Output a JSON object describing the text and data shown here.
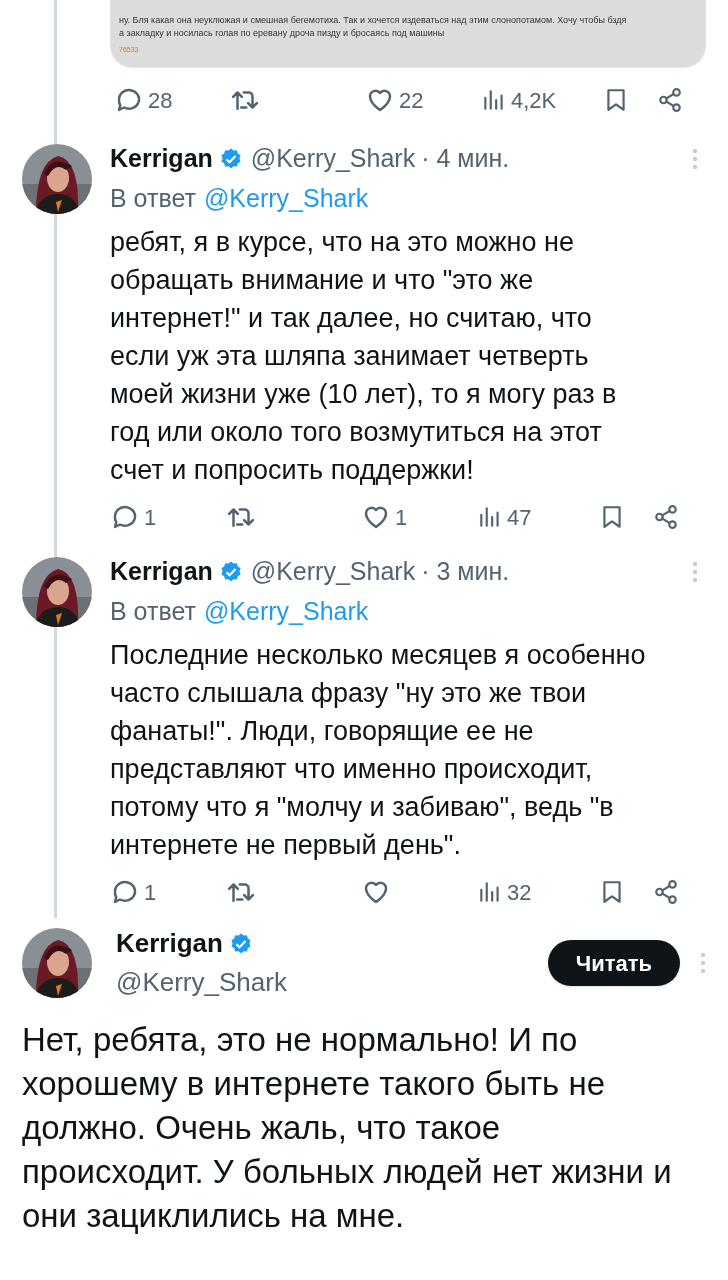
{
  "quoted_image": {
    "lines": [
      "ну. Бля какая она неуклюжая и смешная бегемотиха. Так и хочется издеваться над этим слонопотамом. Хочу чтобы бздя",
      "а закладку и носилась голая по еревану дроча пизду и бросаясь под машины"
    ],
    "number": "76533"
  },
  "top_actions": {
    "replies": "28",
    "likes": "22",
    "views": "4,2K"
  },
  "replies": [
    {
      "name": "Kerrigan",
      "verified": true,
      "handle": "@Kerry_Shark",
      "time": "· 4 мин.",
      "reply_prefix": "В ответ",
      "reply_to": "@Kerry_Shark",
      "text": "ребят, я в курсе, что на это можно не обращать внимание и что \"это же интернет!\" и так далее, но считаю, что если уж эта шляпа занимает четверть моей жизни уже (10 лет), то я могу раз в год или около того возмутиться на этот счет и попросить поддержки!",
      "actions": {
        "replies": "1",
        "likes": "1",
        "views": "47"
      }
    },
    {
      "name": "Kerrigan",
      "verified": true,
      "handle": "@Kerry_Shark",
      "time": "· 3 мин.",
      "reply_prefix": "В ответ",
      "reply_to": "@Kerry_Shark",
      "text": "Последние несколько месяцев я особенно часто слышала фразу \"ну это же твои фанаты!\". Люди, говорящие ее не представляют что именно происходит, потому что я \"молчу и забиваю\", ведь \"в интернете не первый день\".",
      "actions": {
        "replies": "1",
        "views": "32"
      }
    }
  ],
  "main_tweet": {
    "name": "Kerrigan",
    "verified": true,
    "handle": "@Kerry_Shark",
    "follow_button": "Читать",
    "text": "Нет, ребята, это не нормально! И по хорошему в интернете такого быть не должно. Очень жаль, что такое происходит. У больных людей нет жизни и они зациклились на мне."
  }
}
